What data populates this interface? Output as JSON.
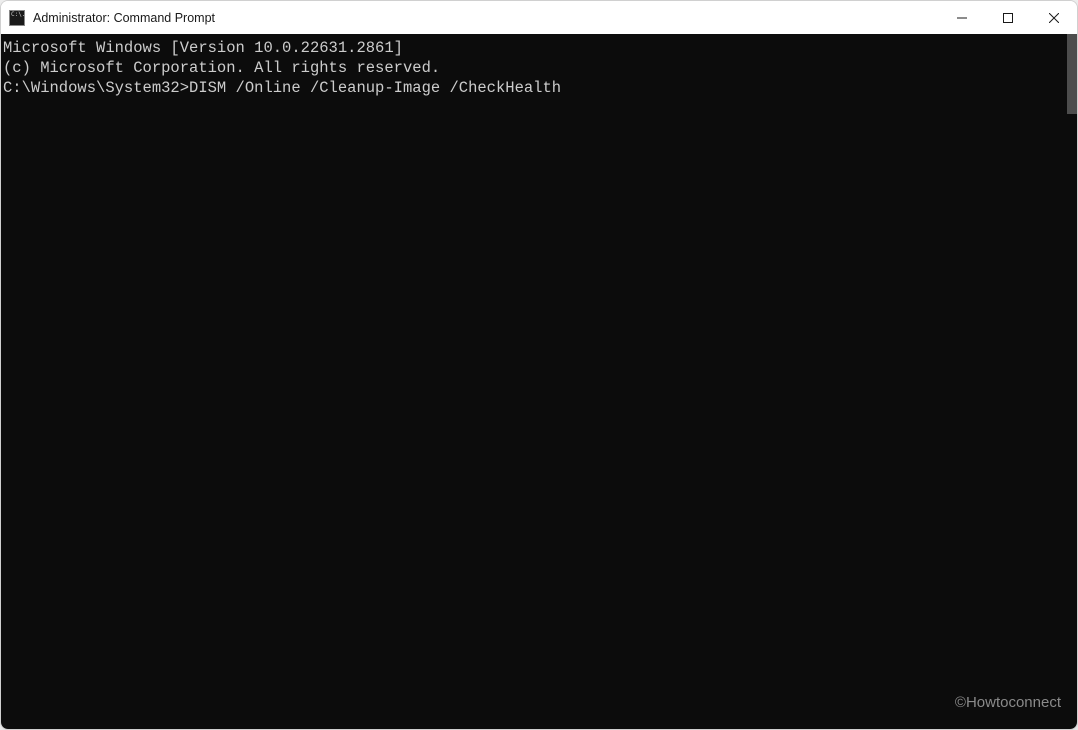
{
  "window": {
    "title": "Administrator: Command Prompt"
  },
  "terminal": {
    "lines": {
      "l0": "Microsoft Windows [Version 10.0.22631.2861]",
      "l1": "(c) Microsoft Corporation. All rights reserved.",
      "l2": "",
      "l3_prompt": "C:\\Windows\\System32>",
      "l3_command": "DISM /Online /Cleanup-Image /CheckHealth"
    }
  },
  "watermark": "©Howtoconnect"
}
